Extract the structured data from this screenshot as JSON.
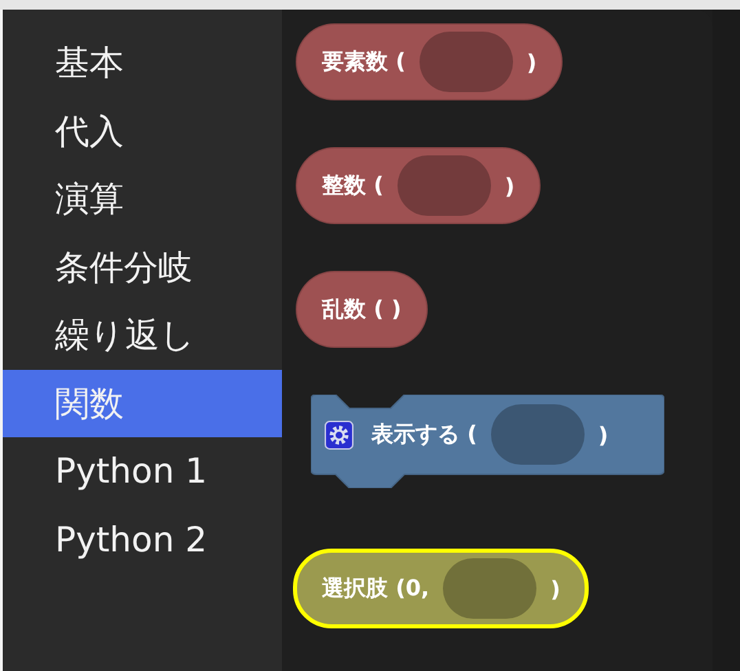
{
  "categories": [
    {
      "label": "基本",
      "selected": false
    },
    {
      "label": "代入",
      "selected": false
    },
    {
      "label": "演算",
      "selected": false
    },
    {
      "label": "条件分岐",
      "selected": false
    },
    {
      "label": "繰り返し",
      "selected": false
    },
    {
      "label": "関数",
      "selected": true
    },
    {
      "label": "Python 1",
      "selected": false
    },
    {
      "label": "Python 2",
      "selected": false
    }
  ],
  "blocks": [
    {
      "kind": "reporter",
      "color": "#9e5152",
      "label": "要素数 (",
      "slot": true,
      "end": ")",
      "highlighted": false
    },
    {
      "kind": "reporter",
      "color": "#9e5152",
      "label": "整数 (",
      "slot": true,
      "end": ")",
      "highlighted": false
    },
    {
      "kind": "reporter",
      "color": "#9e5152",
      "label": "乱数 ( )",
      "slot": false,
      "highlighted": false
    },
    {
      "kind": "statement",
      "color": "#52779e",
      "label": "表示する (",
      "slot": true,
      "end": ")",
      "highlighted": false
    },
    {
      "kind": "reporter",
      "color": "#9b9a4f",
      "label": "選択肢 (0,",
      "slot": true,
      "end": ")",
      "highlighted": true
    }
  ]
}
